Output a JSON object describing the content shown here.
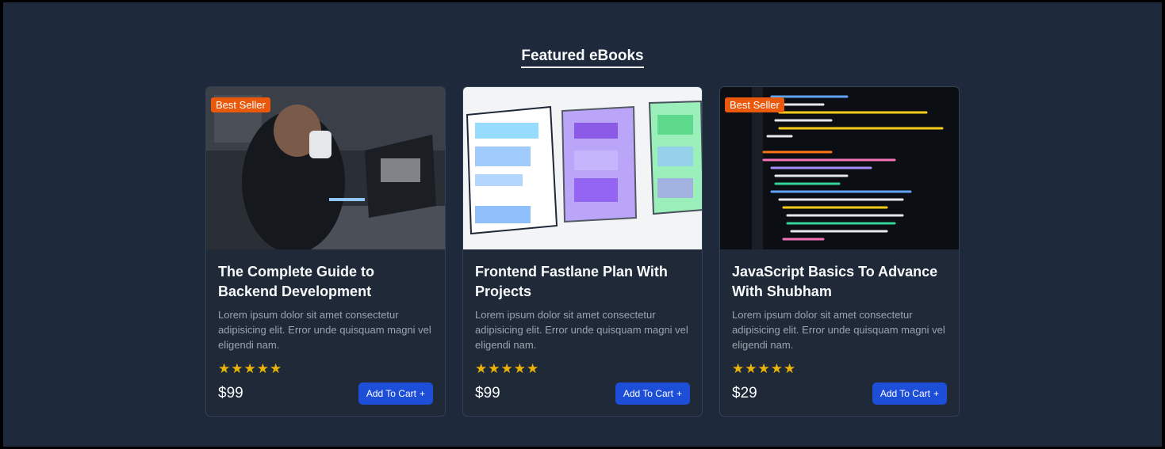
{
  "section": {
    "title": "Featured eBooks"
  },
  "colors": {
    "background": "#1e293b",
    "card": "#1f2937",
    "badge": "#ea580c",
    "button": "#1d4ed8",
    "star": "#eab308"
  },
  "cards": [
    {
      "badge": "Best Seller",
      "title": "The Complete Guide to Backend Development",
      "description": "Lorem ipsum dolor sit amet consectetur adipisicing elit. Error unde quisquam magni vel eligendi nam.",
      "rating": 5,
      "stars": "★★★★★",
      "price": "$99",
      "button": "Add To Cart",
      "button_icon": "+"
    },
    {
      "badge": "",
      "title": "Frontend Fastlane Plan With Projects",
      "description": "Lorem ipsum dolor sit amet consectetur adipisicing elit. Error unde quisquam magni vel eligendi nam.",
      "rating": 5,
      "stars": "★★★★★",
      "price": "$99",
      "button": "Add To Cart",
      "button_icon": "+"
    },
    {
      "badge": "Best Seller",
      "title": "JavaScript Basics To Advance With Shubham",
      "description": "Lorem ipsum dolor sit amet consectetur adipisicing elit. Error unde quisquam magni vel eligendi nam.",
      "rating": 5,
      "stars": "★★★★★",
      "price": "$29",
      "button": "Add To Cart",
      "button_icon": "+"
    }
  ]
}
